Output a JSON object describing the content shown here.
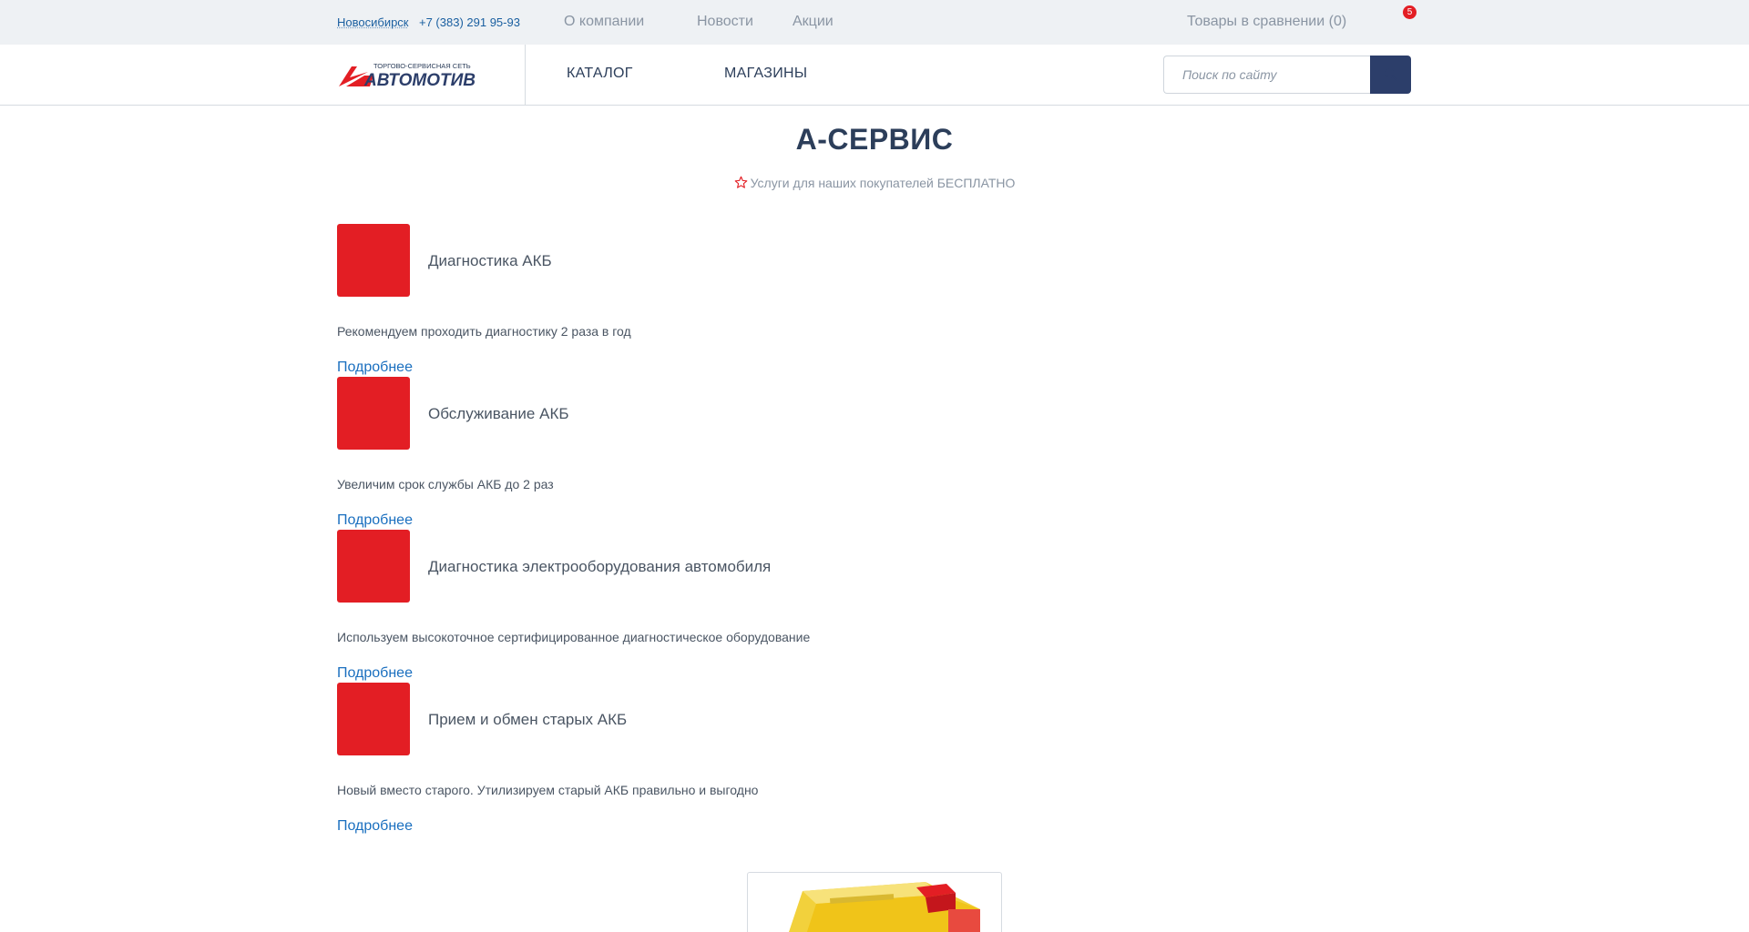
{
  "topbar": {
    "city": "Новосибирск",
    "phone": "+7 (383) 291 95-93",
    "nav": [
      "О компании",
      "Новости",
      "Акции"
    ],
    "compare": "Товары в сравнении (0)",
    "cart_count": "5"
  },
  "header": {
    "logo_tagline": "ТОРГОВО-СЕРВИСНАЯ СЕТЬ",
    "logo_name": "АВТОМОТИВ",
    "nav": [
      "КАТАЛОГ",
      "МАГАЗИНЫ"
    ],
    "search_placeholder": "Поиск по сайту"
  },
  "page": {
    "title": "А-СЕРВИС",
    "subtitle": "Услуги для наших покупателей БЕСПЛАТНО"
  },
  "services": [
    {
      "title": "Диагностика АКБ",
      "desc": "Рекомендуем проходить диагностику 2 раза в год",
      "more": "Подробнее"
    },
    {
      "title": "Обслуживание АКБ",
      "desc": "Увеличим срок службы АКБ до 2 раз",
      "more": "Подробнее"
    },
    {
      "title": "Диагностика электрооборудования автомобиля",
      "desc": "Используем высокоточное сертифицированное диагностическое оборудование",
      "more": "Подробнее"
    },
    {
      "title": "Прием и обмен старых АКБ",
      "desc": "Новый вместо старого. Утилизируем старый АКБ правильно и выгодно",
      "more": "Подробнее"
    }
  ],
  "colors": {
    "brand_red": "#e31e24",
    "navy": "#2c3e6a",
    "link": "#1a6fbf",
    "topbar_bg": "#eef1f4"
  },
  "icons": {
    "subtitle": "star-outline-icon",
    "search": "search-icon"
  }
}
